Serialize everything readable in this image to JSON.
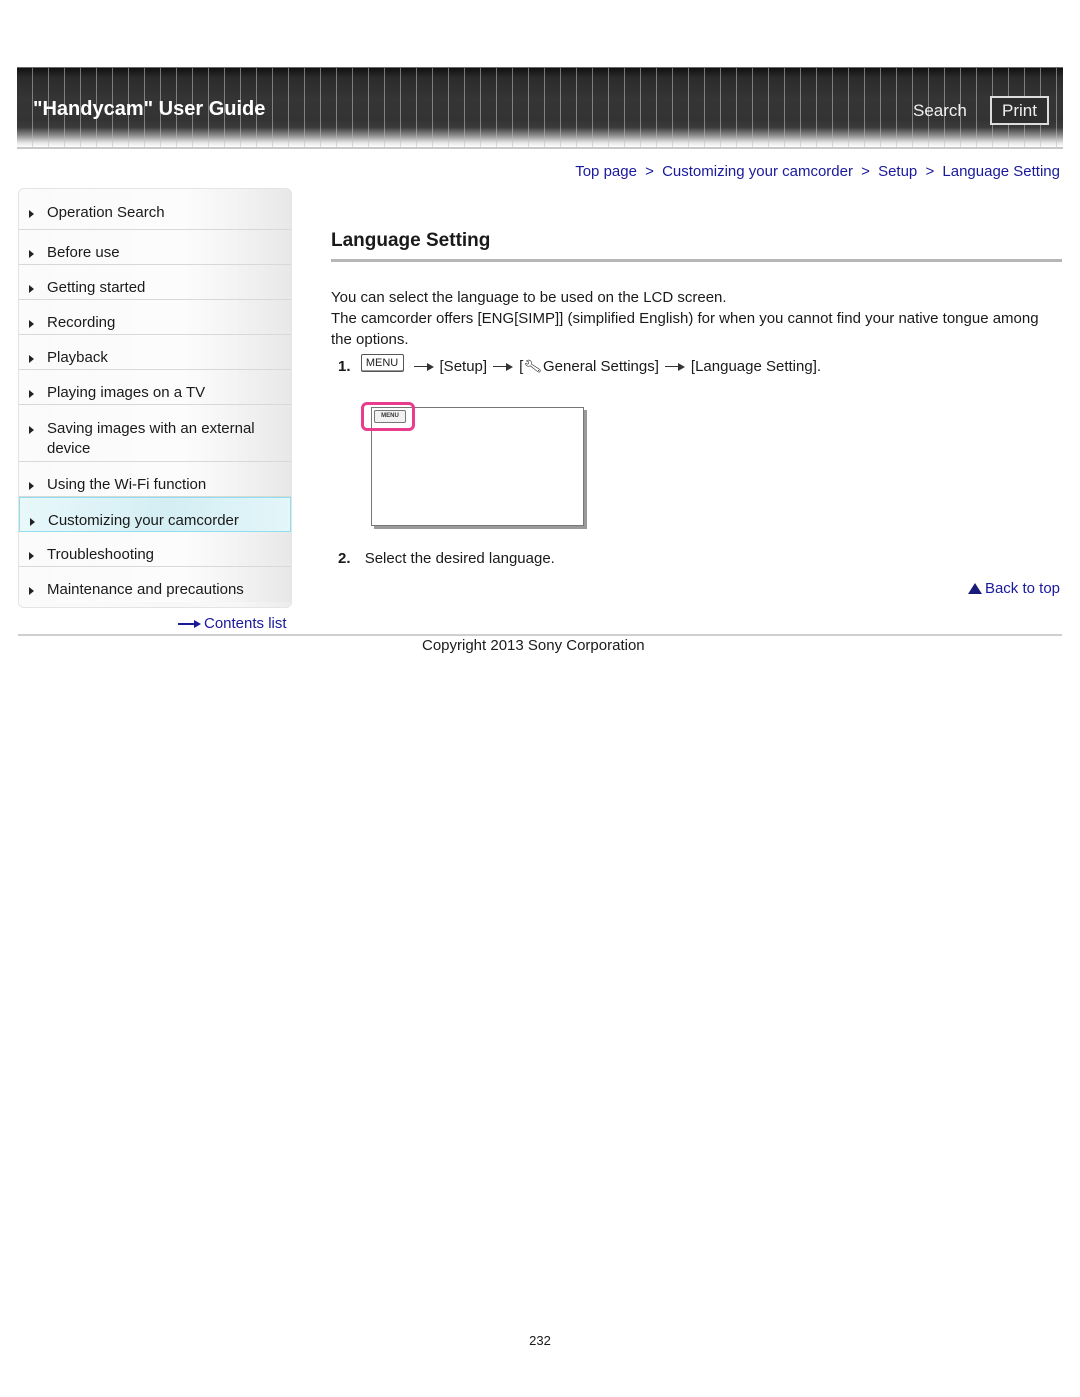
{
  "header": {
    "title": "\"Handycam\" User Guide",
    "search_label": "Search",
    "print_label": "Print"
  },
  "breadcrumb": {
    "items": [
      "Top page",
      "Customizing your camcorder",
      "Setup",
      "Language Setting"
    ],
    "separator": ">"
  },
  "sidebar": {
    "items": [
      {
        "label": "Operation Search",
        "icon": "triangle-right-icon"
      },
      {
        "label": "Before use",
        "icon": "triangle-right-icon"
      },
      {
        "label": "Getting started",
        "icon": "triangle-right-icon"
      },
      {
        "label": "Recording",
        "icon": "triangle-right-icon"
      },
      {
        "label": "Playback",
        "icon": "triangle-right-icon"
      },
      {
        "label": "Playing images on a TV",
        "icon": "triangle-right-icon"
      },
      {
        "label": "Saving images with an external device",
        "icon": "triangle-right-icon"
      },
      {
        "label": "Using the Wi-Fi function",
        "icon": "triangle-right-icon"
      },
      {
        "label": "Customizing your camcorder",
        "icon": "triangle-right-icon",
        "selected": true
      },
      {
        "label": "Troubleshooting",
        "icon": "triangle-right-icon"
      },
      {
        "label": "Maintenance and precautions",
        "icon": "triangle-right-icon"
      }
    ],
    "contents_list_label": "Contents list",
    "contents_list_icon": "arrow-right-icon"
  },
  "main": {
    "title": "Language Setting",
    "intro_line1": "You can select the language to be used on the LCD screen.",
    "intro_line2": "The camcorder offers [ENG[SIMP]] (simplified English) for when you cannot find your native tongue among the options.",
    "steps": [
      {
        "number": "1.",
        "menu_button": "MENU",
        "parts": [
          "[Setup]",
          "[",
          "General Settings]",
          "[Language Setting]."
        ],
        "wrench_icon": "wrench-icon"
      },
      {
        "number": "2.",
        "text": "Select the desired language."
      }
    ],
    "illustration": {
      "menu_label": "MENU",
      "highlight_color": "#e83c8f"
    },
    "back_to_top_label": "Back to top"
  },
  "footer": {
    "copyright": "Copyright 2013 Sony Corporation",
    "page_number": "232"
  },
  "colors": {
    "link": "#1a1a9c",
    "selected_border": "#8fdfef",
    "header_bg": "#333333"
  }
}
